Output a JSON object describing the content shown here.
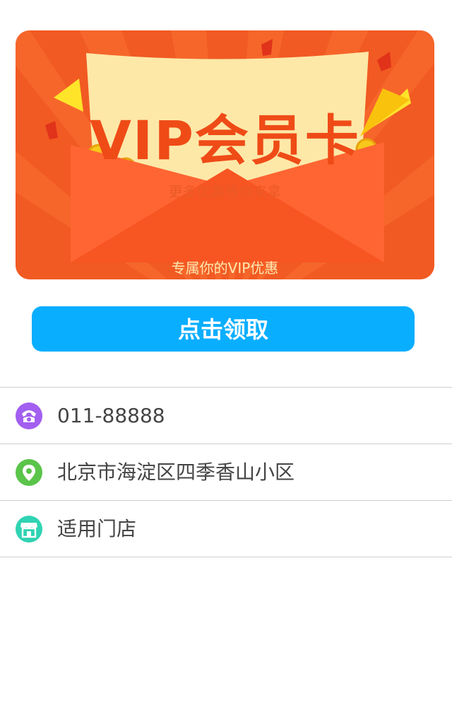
{
  "banner": {
    "title": "VIP会员卡",
    "subtitle": "更多优惠等你来拿",
    "tagline": "专属你的VIP优惠"
  },
  "claim_button": {
    "label": "点击领取"
  },
  "info": {
    "phone": {
      "text": "011-88888",
      "icon": "phone-icon",
      "color": "#a25ff0"
    },
    "address": {
      "text": "北京市海淀区四季香山小区",
      "icon": "location-pin-icon",
      "color": "#5bc44a"
    },
    "stores": {
      "text": "适用门店",
      "icon": "store-icon",
      "color": "#2fd3b2"
    }
  },
  "colors": {
    "banner_background": "#f15a22",
    "ticket": "#fde8a8",
    "button": "#0aaeff"
  }
}
